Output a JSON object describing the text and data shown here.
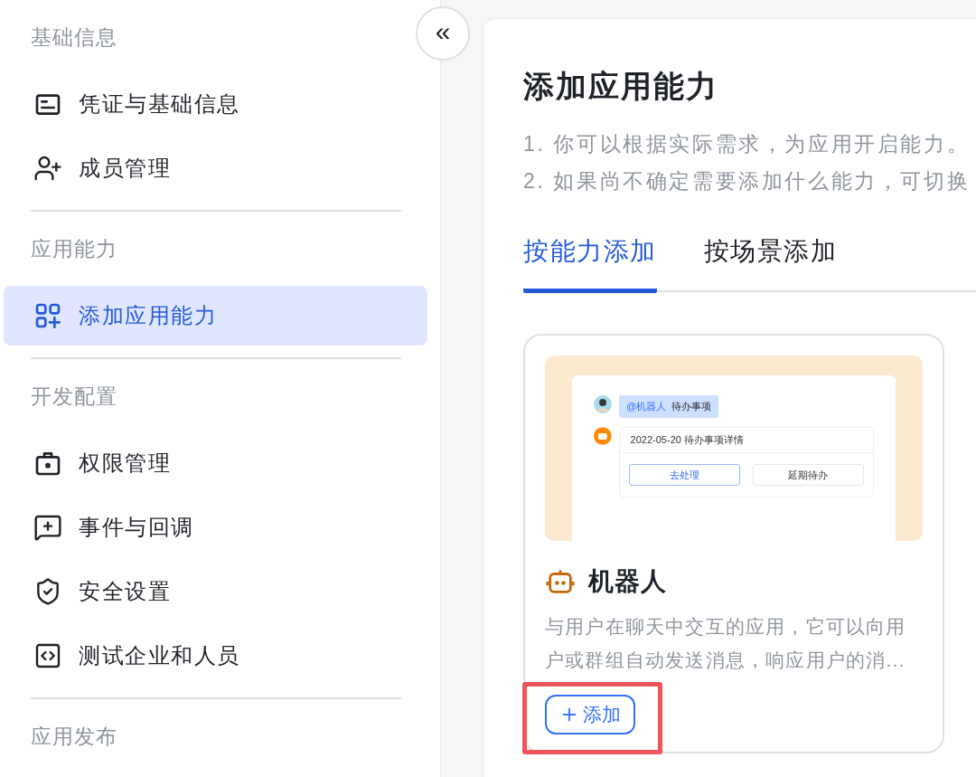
{
  "sidebar": {
    "collapse_button": {
      "label": "«"
    },
    "sections": [
      {
        "title": "基础信息",
        "items": [
          {
            "label": "凭证与基础信息",
            "selected": false
          },
          {
            "label": "成员管理",
            "selected": false
          }
        ]
      },
      {
        "title": "应用能力",
        "items": [
          {
            "label": "添加应用能力",
            "selected": true
          }
        ]
      },
      {
        "title": "开发配置",
        "items": [
          {
            "label": "权限管理",
            "selected": false
          },
          {
            "label": "事件与回调",
            "selected": false
          },
          {
            "label": "安全设置",
            "selected": false
          },
          {
            "label": "测试企业和人员",
            "selected": false
          }
        ]
      },
      {
        "title": "应用发布"
      }
    ]
  },
  "main": {
    "title": "添加应用能力",
    "description": [
      "1. 你可以根据实际需求，为应用开启能力。",
      "2. 如果尚不确定需要添加什么能力，可切换"
    ],
    "tabs": [
      {
        "label": "按能力添加",
        "selected": true
      },
      {
        "label": "按场景添加",
        "selected": false
      }
    ],
    "cards": [
      {
        "title": "机器人",
        "description": "与用户在聊天中交互的应用，它可以向用户或群组自动发送消息，响应用户的消...",
        "add_button": {
          "label": "添加",
          "highlighted": true
        },
        "preview": {
          "mention": "@机器人",
          "message": "待办事项",
          "card_title": "2022-05-20 待办事项详情",
          "actions": [
            {
              "label": "去处理",
              "kind": "primary"
            },
            {
              "label": "延期待办",
              "kind": "default"
            }
          ]
        }
      }
    ]
  }
}
